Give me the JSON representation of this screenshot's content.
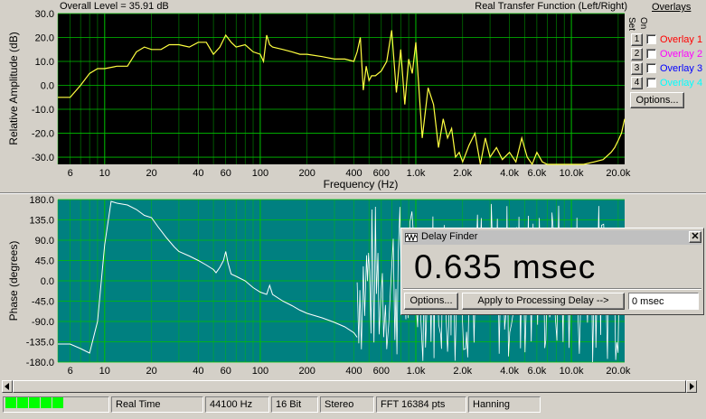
{
  "top_plot": {
    "header_left": "Overall Level = 35.91 dB",
    "header_right": "Real Transfer Function (Left/Right)",
    "ylabel": "Relative Amplitude (dB)",
    "xlabel": "Frequency (Hz)"
  },
  "bottom_plot": {
    "ylabel": "Phase (degrees)"
  },
  "overlays": {
    "title": "Overlays",
    "set_label": "Set",
    "on_label": "On",
    "items": [
      {
        "num": "1",
        "label": "Overlay 1",
        "color": "#ff0000"
      },
      {
        "num": "2",
        "label": "Overlay 2",
        "color": "#ff00ff"
      },
      {
        "num": "3",
        "label": "Overlay 3",
        "color": "#0000ff"
      },
      {
        "num": "4",
        "label": "Overlay 4",
        "color": "#00ffff"
      }
    ],
    "options_label": "Options..."
  },
  "delay_finder": {
    "title": "Delay Finder",
    "value": "0.635 msec",
    "options_label": "Options...",
    "apply_label": "Apply to Processing Delay -->",
    "delay_input_value": "0 msec"
  },
  "status_bar": {
    "mode": "Real Time",
    "sample_rate": "44100 Hz",
    "bit_depth": "16 Bit",
    "channels": "Stereo",
    "fft": "FFT 16384 pts",
    "window": "Hanning"
  },
  "colors": {
    "amp_bg": "#000000",
    "amp_trace": "#ffff40",
    "phase_bg": "#008080",
    "phase_trace": "#ffffff",
    "grid": "#00c000",
    "level_meter": "#00ff00"
  },
  "chart_data": [
    {
      "type": "line",
      "xscale": "log",
      "xlim": [
        5,
        22000
      ],
      "ylim": [
        -33,
        30
      ],
      "xlabel": "Frequency (Hz)",
      "ylabel": "Relative Amplitude (dB)",
      "yticks": [
        "30.0",
        "20.0",
        "10.0",
        "0.0",
        "-10.0",
        "-20.0",
        "-30.0"
      ],
      "ytick_values": [
        30,
        20,
        10,
        0,
        -10,
        -20,
        -30
      ],
      "xticks": [
        "6",
        "10",
        "20",
        "40",
        "60",
        "100",
        "200",
        "400",
        "600",
        "1.0k",
        "2.0k",
        "4.0k",
        "6.0k",
        "10.0k",
        "20.0k"
      ],
      "xtick_values": [
        6,
        10,
        20,
        40,
        60,
        100,
        200,
        400,
        600,
        1000,
        2000,
        4000,
        6000,
        10000,
        20000
      ],
      "x": [
        5,
        6,
        7,
        8,
        9,
        10,
        12,
        14,
        16,
        18,
        20,
        23,
        26,
        30,
        35,
        40,
        45,
        50,
        55,
        60,
        65,
        70,
        80,
        90,
        100,
        105,
        110,
        115,
        120,
        140,
        160,
        180,
        200,
        250,
        300,
        350,
        400,
        420,
        440,
        460,
        480,
        500,
        520,
        550,
        600,
        650,
        700,
        750,
        800,
        850,
        900,
        950,
        1000,
        1100,
        1200,
        1300,
        1400,
        1500,
        1600,
        1700,
        1800,
        1900,
        2000,
        2200,
        2400,
        2600,
        2800,
        3000,
        3300,
        3600,
        4000,
        4400,
        4800,
        5200,
        5600,
        6000,
        6500,
        7000,
        8000,
        9000,
        10000,
        12000,
        14000,
        16000,
        18000,
        19000,
        20000,
        21000,
        22000
      ],
      "y": [
        -5,
        -5,
        0,
        5,
        7,
        7,
        8,
        8,
        14,
        16,
        15,
        15,
        17,
        17,
        16,
        18,
        18,
        13,
        16,
        21,
        18,
        16,
        17,
        14,
        13,
        10,
        21,
        17,
        16,
        15,
        14,
        13,
        13,
        12,
        11,
        11,
        10,
        14,
        20,
        -2,
        8,
        2,
        4,
        4,
        6,
        10,
        23,
        -3,
        15,
        -8,
        11,
        5,
        18,
        -22,
        -1,
        -8,
        -26,
        -14,
        -22,
        -18,
        -30,
        -28,
        -32,
        -25,
        -20,
        -33,
        -22,
        -30,
        -26,
        -31,
        -28,
        -32,
        -22,
        -30,
        -33,
        -28,
        -32,
        -33,
        -33,
        -33,
        -33,
        -33,
        -32,
        -31,
        -28,
        -26,
        -23,
        -20,
        -14
      ]
    },
    {
      "type": "line",
      "xscale": "log",
      "xlim": [
        5,
        22000
      ],
      "ylim": [
        -180,
        180
      ],
      "ylabel": "Phase (degrees)",
      "yticks": [
        "180.0",
        "135.0",
        "90.0",
        "45.0",
        "0.0",
        "-45.0",
        "-90.0",
        "-135.0",
        "-180.0"
      ],
      "ytick_values": [
        180,
        135,
        90,
        45,
        0,
        -45,
        -90,
        -135,
        -180
      ],
      "xticks": [
        "6",
        "10",
        "20",
        "40",
        "60",
        "100",
        "200",
        "400",
        "600",
        "1.0k",
        "2.0k",
        "4.0k",
        "6.0k",
        "10.0k",
        "20.0k"
      ],
      "xtick_values": [
        6,
        10,
        20,
        40,
        60,
        100,
        200,
        400,
        600,
        1000,
        2000,
        4000,
        6000,
        10000,
        20000
      ],
      "x": [
        5,
        6,
        7,
        8,
        9,
        10,
        11,
        12,
        14,
        16,
        18,
        20,
        22,
        25,
        28,
        30,
        35,
        40,
        45,
        50,
        52,
        55,
        58,
        60,
        62,
        65,
        70,
        80,
        90,
        100,
        110,
        115,
        120,
        140,
        160,
        180,
        200,
        250,
        300,
        350,
        400,
        420
      ],
      "y": [
        -140,
        -140,
        -150,
        -160,
        -90,
        80,
        176,
        172,
        168,
        158,
        145,
        140,
        120,
        95,
        75,
        65,
        55,
        45,
        35,
        25,
        18,
        30,
        45,
        65,
        40,
        15,
        10,
        0,
        -15,
        -25,
        -30,
        -10,
        -30,
        -45,
        -55,
        -65,
        -72,
        -82,
        -92,
        -102,
        -115,
        -125
      ]
    }
  ]
}
